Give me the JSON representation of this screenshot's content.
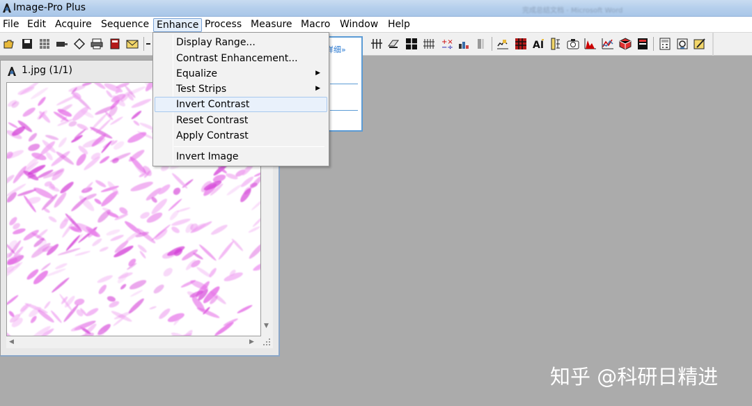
{
  "app": {
    "title": "Image-Pro Plus",
    "titlebar_right": "完成总结文档 - Microsoft Word"
  },
  "menubar": [
    "File",
    "Edit",
    "Acquire",
    "Sequence",
    "Enhance",
    "Process",
    "Measure",
    "Macro",
    "Window",
    "Help"
  ],
  "enhance_menu": {
    "items": [
      {
        "label": "Display Range...",
        "submenu": false
      },
      {
        "label": "Contrast Enhancement...",
        "submenu": false
      },
      {
        "label": "Equalize",
        "submenu": true
      },
      {
        "label": "Test Strips",
        "submenu": true
      },
      {
        "label": "Invert Contrast",
        "submenu": false,
        "highlighted": true
      },
      {
        "label": "Reset Contrast",
        "submenu": false
      },
      {
        "label": "Apply Contrast",
        "submenu": false
      },
      {
        "label": "Invert Image",
        "submenu": false
      }
    ]
  },
  "toolbar": {
    "left_icons": [
      "open-icon",
      "save-icon",
      "grid-icon",
      "camera-icon",
      "lasso-icon",
      "print-icon",
      "book-icon",
      "mail-icon"
    ],
    "right_icons": [
      "grid-tool-icon",
      "measure-icon",
      "black-square-icon",
      "grid-dots-icon",
      "plus-minus-icon",
      "bar-icon",
      "column-icon",
      "chart-icon",
      "red-grid-icon",
      "ai-icon",
      "ruler-icon",
      "camera2-icon",
      "histogram-icon",
      "line-plot-icon",
      "cube-icon",
      "book2-icon",
      "calc-icon",
      "script-icon",
      "edit-icon"
    ]
  },
  "popup": {
    "detail_label": "详细»"
  },
  "image_window": {
    "title": "1.jpg (1/1)"
  },
  "watermark": "知乎 @科研日精进",
  "colors": {
    "stain": "#e060e0",
    "highlight": "#e9f1fb",
    "background": "#ababab"
  }
}
